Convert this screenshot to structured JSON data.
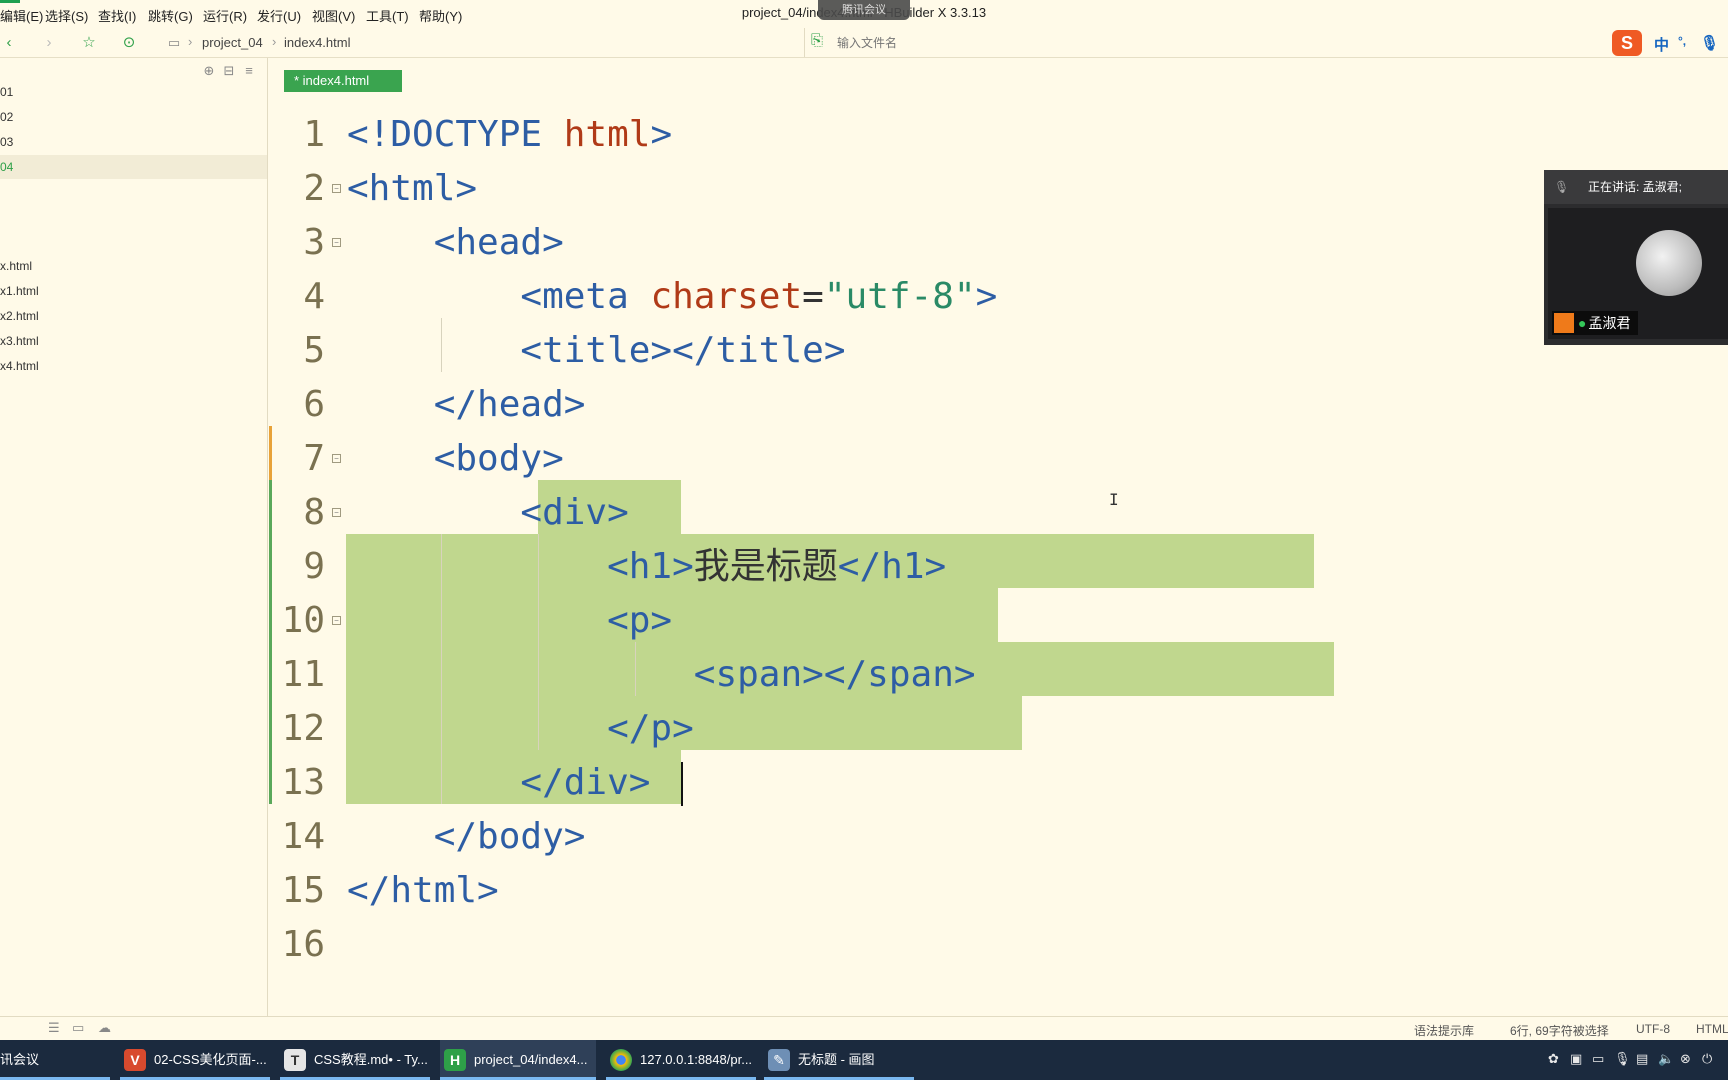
{
  "menubar": {
    "items": [
      "编辑(E)",
      "选择(S)",
      "查找(I)",
      "跳转(G)",
      "运行(R)",
      "发行(U)",
      "视图(V)",
      "工具(T)",
      "帮助(Y)"
    ],
    "window_title": "project_04/index4.html - HBuilder X 3.3.13",
    "meeting_pill": "腾讯会议"
  },
  "toolbar": {
    "breadcrumb": [
      "project_04",
      "index4.html"
    ],
    "search_placeholder": "输入文件名",
    "ime": {
      "logo": "S",
      "lang": "中",
      "punct": "°,"
    }
  },
  "sidebar": {
    "items": [
      "01",
      "02",
      "03",
      "04",
      "x.html",
      "x1.html",
      "x2.html",
      "x3.html",
      "x4.html"
    ],
    "active_item": "04"
  },
  "editor": {
    "tab_label": "* index4.html",
    "lines": [
      {
        "num": "1"
      },
      {
        "num": "2"
      },
      {
        "num": "3"
      },
      {
        "num": "4"
      },
      {
        "num": "5"
      },
      {
        "num": "6"
      },
      {
        "num": "7"
      },
      {
        "num": "8"
      },
      {
        "num": "9"
      },
      {
        "num": "10"
      },
      {
        "num": "11"
      },
      {
        "num": "12"
      },
      {
        "num": "13"
      },
      {
        "num": "14"
      },
      {
        "num": "15"
      },
      {
        "num": "16"
      }
    ],
    "code": {
      "l1a": "<!DOCTYPE ",
      "l1b": "html",
      "l1c": ">",
      "l2": "<html>",
      "l3": "    <head>",
      "l4a": "        <meta ",
      "l4b": "charset",
      "l4c": "=",
      "l4d": "\"utf-8\"",
      "l4e": ">",
      "l5": "        <title></title>",
      "l6": "    </head>",
      "l7": "    <body>",
      "l8": "        <div>",
      "l9a": "            <h1>",
      "l9b": "我是标题",
      "l9c": "</h1>",
      "l10": "            <p>",
      "l11": "                <span></span>",
      "l12": "            </p>",
      "l13": "        </div>",
      "l14": "    </body>",
      "l15": "</html>",
      "l16": ""
    }
  },
  "meeting": {
    "speaking_label": "正在讲话: 孟淑君;",
    "user_name": "孟淑君"
  },
  "statusbar": {
    "hint": "语法提示库",
    "position": "6行, 69字符被选择",
    "encoding": "UTF-8",
    "language": "HTML"
  },
  "taskbar": {
    "tasks": [
      "讯会议",
      "02-CSS美化页面-...",
      "CSS教程.md• - Ty...",
      "project_04/index4...",
      "127.0.0.1:8848/pr...",
      "无标题 - 画图"
    ]
  },
  "colors": {
    "editor_bg": "#fffae8",
    "selection": "#c0d78e",
    "tag": "#2d5da4",
    "keyword": "#b03a17",
    "string": "#2a8a66",
    "accent_green": "#3aa44f",
    "taskbar_bg": "#1b2a3e"
  }
}
